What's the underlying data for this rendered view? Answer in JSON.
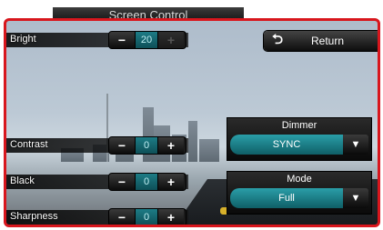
{
  "header": {
    "title": "Screen Control"
  },
  "return_button": {
    "label": "Return",
    "icon": "return-arrow-icon",
    "glyph": "⮌"
  },
  "controls": {
    "bright": {
      "label": "Bright",
      "value": "20",
      "minus": "−",
      "plus": "+"
    },
    "contrast": {
      "label": "Contrast",
      "value": "0",
      "minus": "−",
      "plus": "+"
    },
    "black": {
      "label": "Black",
      "value": "0",
      "minus": "−",
      "plus": "+"
    },
    "sharpness": {
      "label": "Sharpness",
      "value": "0",
      "minus": "−",
      "plus": "+"
    }
  },
  "dimmer": {
    "title": "Dimmer",
    "value": "SYNC",
    "arrow": "▼"
  },
  "mode": {
    "title": "Mode",
    "value": "Full",
    "arrow": "▼"
  },
  "colors": {
    "frame_border": "#d8161d",
    "accent_teal": "#1d8e98"
  }
}
